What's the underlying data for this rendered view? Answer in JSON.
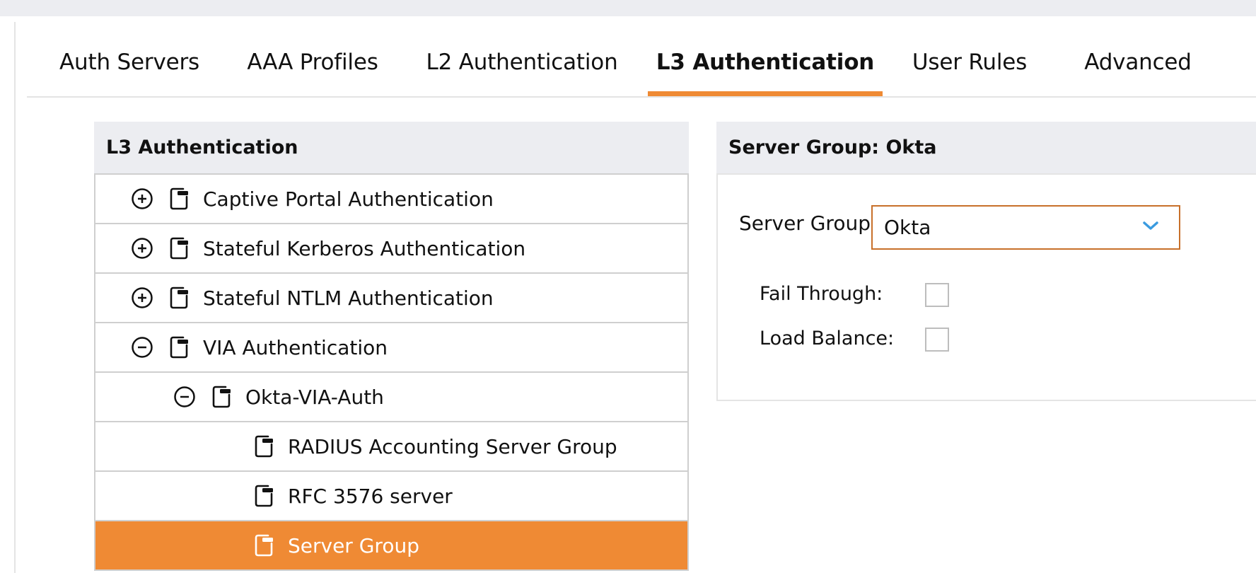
{
  "tabs": [
    {
      "label": "Auth Servers",
      "active": false
    },
    {
      "label": "AAA Profiles",
      "active": false
    },
    {
      "label": "L2 Authentication",
      "active": false
    },
    {
      "label": "L3 Authentication",
      "active": true
    },
    {
      "label": "User Rules",
      "active": false
    },
    {
      "label": "Advanced",
      "active": false
    }
  ],
  "left_panel": {
    "title": "L3 Authentication",
    "items": [
      {
        "label": "Captive Portal Authentication",
        "level": 0,
        "toggle": "expand",
        "icon": "document-icon",
        "selected": false
      },
      {
        "label": "Stateful Kerberos Authentication",
        "level": 0,
        "toggle": "expand",
        "icon": "document-icon",
        "selected": false
      },
      {
        "label": "Stateful NTLM Authentication",
        "level": 0,
        "toggle": "expand",
        "icon": "document-icon",
        "selected": false
      },
      {
        "label": "VIA Authentication",
        "level": 0,
        "toggle": "collapse",
        "icon": "document-icon",
        "selected": false
      },
      {
        "label": "Okta-VIA-Auth",
        "level": 1,
        "toggle": "collapse",
        "icon": "document-icon",
        "selected": false
      },
      {
        "label": "RADIUS Accounting Server Group",
        "level": 2,
        "toggle": "none",
        "icon": "document-icon",
        "selected": false
      },
      {
        "label": "RFC 3576 server",
        "level": 2,
        "toggle": "none",
        "icon": "document-icon",
        "selected": false
      },
      {
        "label": "Server Group",
        "level": 2,
        "toggle": "none",
        "icon": "document-icon",
        "selected": true
      }
    ]
  },
  "right_panel": {
    "title": "Server Group: Okta",
    "server_group_label": "Server Group:",
    "server_group_value": "Okta",
    "fail_through_label": "Fail Through:",
    "fail_through_checked": false,
    "load_balance_label": "Load Balance:",
    "load_balance_checked": false
  },
  "colors": {
    "accent": "#EF8A34",
    "select_border": "#C8702A",
    "chevron": "#3A9BE0",
    "header_bg": "#ECEDF1"
  }
}
